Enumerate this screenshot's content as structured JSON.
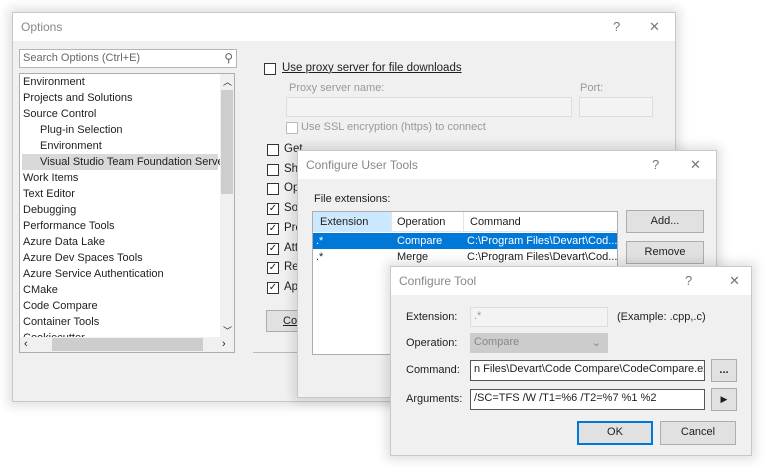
{
  "options": {
    "title": "Options",
    "help": "?",
    "close": "✕",
    "search_placeholder": "Search Options (Ctrl+E)",
    "tree": [
      {
        "label": "Environment",
        "level": 0
      },
      {
        "label": "Projects and Solutions",
        "level": 0
      },
      {
        "label": "Source Control",
        "level": 0
      },
      {
        "label": "Plug-in Selection",
        "level": 1
      },
      {
        "label": "Environment",
        "level": 1
      },
      {
        "label": "Visual Studio Team Foundation Server",
        "level": 1,
        "selected": true
      },
      {
        "label": "Work Items",
        "level": 0
      },
      {
        "label": "Text Editor",
        "level": 0
      },
      {
        "label": "Debugging",
        "level": 0
      },
      {
        "label": "Performance Tools",
        "level": 0
      },
      {
        "label": "Azure Data Lake",
        "level": 0
      },
      {
        "label": "Azure Dev Spaces Tools",
        "level": 0
      },
      {
        "label": "Azure Service Authentication",
        "level": 0
      },
      {
        "label": "CMake",
        "level": 0
      },
      {
        "label": "Code Compare",
        "level": 0
      },
      {
        "label": "Container Tools",
        "level": 0
      },
      {
        "label": "Cookiecutter",
        "level": 0
      }
    ],
    "proxy_label": "Use proxy server for file downloads",
    "proxy_name_label": "Proxy server name:",
    "port_label": "Port:",
    "ssl_label": "Use SSL encryption (https) to connect",
    "checks": [
      {
        "label": "Get",
        "checked": false
      },
      {
        "label": "Sho",
        "checked": false
      },
      {
        "label": "Op",
        "checked": false
      },
      {
        "label": "Sol",
        "checked": true
      },
      {
        "label": "Pro",
        "checked": true
      },
      {
        "label": "Att",
        "checked": true
      },
      {
        "label": "Res",
        "checked": true
      },
      {
        "label": "Ap",
        "checked": true
      }
    ],
    "config_button": "Co"
  },
  "user_tools": {
    "title": "Configure User Tools",
    "help": "?",
    "close": "✕",
    "file_ext_label": "File extensions:",
    "columns": [
      "Extension",
      "Operation",
      "Command"
    ],
    "rows": [
      {
        "ext": ".*",
        "op": "Compare",
        "cmd": "C:\\Program Files\\Devart\\Cod...",
        "selected": true
      },
      {
        "ext": ".*",
        "op": "Merge",
        "cmd": "C:\\Program Files\\Devart\\Cod..."
      }
    ],
    "add": "Add...",
    "remove": "Remove"
  },
  "tool": {
    "title": "Configure Tool",
    "help": "?",
    "close": "✕",
    "ext_label": "Extension:",
    "ext_value": ".*",
    "ext_example": "(Example: .cpp,.c)",
    "op_label": "Operation:",
    "op_value": "Compare",
    "cmd_label": "Command:",
    "cmd_value": "n Files\\Devart\\Code Compare\\CodeCompare.exe",
    "browse": "...",
    "args_label": "Arguments:",
    "args_value": "/SC=TFS /W /T1=%6 /T2=%7 %1 %2",
    "args_arrow": "▶",
    "ok": "OK",
    "cancel": "Cancel"
  },
  "colors": {
    "selection": "#0078d7",
    "header_selected": "#cce8ff"
  }
}
